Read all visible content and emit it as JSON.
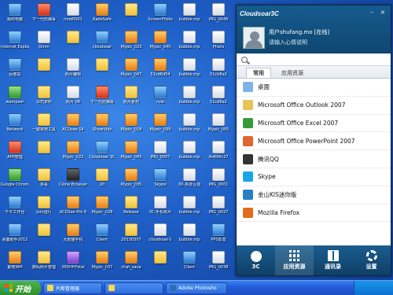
{
  "desktop": {
    "rows": [
      {
        "icons": [
          {
            "label": "我的电脑",
            "kind": "blue"
          },
          {
            "label": "下一代防病毒",
            "kind": "red"
          },
          {
            "label": "mod0001",
            "kind": "doc"
          },
          {
            "label": "RadeSafe",
            "kind": "orange"
          },
          {
            "label": "",
            "kind": "folder"
          },
          {
            "label": "ScreenPhoto",
            "kind": "blue"
          },
          {
            "label": "bubble.mp",
            "kind": "doc"
          },
          {
            "label": "IMG_0046",
            "kind": "doc"
          }
        ]
      },
      {
        "icons": [
          {
            "label": "Internet Explorer",
            "kind": "blue"
          },
          {
            "label": "Dmm",
            "kind": "doc"
          },
          {
            "label": "",
            "kind": "folder"
          },
          {
            "label": "cloudsoar",
            "kind": "blue"
          },
          {
            "label": "Mypic_023",
            "kind": "orange"
          },
          {
            "label": "Mypic_040",
            "kind": "orange"
          },
          {
            "label": "bubble.mp",
            "kind": "doc"
          },
          {
            "label": "Photo",
            "kind": "doc"
          }
        ]
      },
      {
        "icons": [
          {
            "label": "回收站",
            "kind": "blue"
          },
          {
            "label": "",
            "kind": "folder"
          },
          {
            "label": "照片编辑",
            "kind": "doc"
          },
          {
            "label": "",
            "kind": "folder"
          },
          {
            "label": "Mypic_047",
            "kind": "orange"
          },
          {
            "label": "51cd6d54",
            "kind": "orange"
          },
          {
            "label": "bubble.mp",
            "kind": "doc"
          },
          {
            "label": "51cb8a2",
            "kind": "doc"
          }
        ]
      },
      {
        "icons": [
          {
            "label": "wampser",
            "kind": "green"
          },
          {
            "label": "公司资料",
            "kind": "folder"
          },
          {
            "label": "照片 08",
            "kind": "doc"
          },
          {
            "label": "下一代防病毒",
            "kind": "red"
          },
          {
            "label": "照片素材",
            "kind": "folder"
          },
          {
            "label": "rule",
            "kind": "blue"
          },
          {
            "label": "bubble.mp",
            "kind": "doc"
          },
          {
            "label": "51cd8a2",
            "kind": "doc"
          }
        ]
      },
      {
        "icons": [
          {
            "label": "Network",
            "kind": "blue"
          },
          {
            "label": "一键常用工具",
            "kind": "folder"
          },
          {
            "label": "ACDsee 14",
            "kind": "orange"
          },
          {
            "label": "ShowVidz",
            "kind": "orange"
          },
          {
            "label": "Mypic_018",
            "kind": "orange"
          },
          {
            "label": "Mypic_099",
            "kind": "orange"
          },
          {
            "label": "bubble.mp",
            "kind": "doc"
          },
          {
            "label": "Mypic_005",
            "kind": "doc"
          }
        ]
      },
      {
        "icons": [
          {
            "label": "APP管理",
            "kind": "red"
          },
          {
            "label": "",
            "kind": "folder"
          },
          {
            "label": "Mypic_022",
            "kind": "orange"
          },
          {
            "label": "Cloudsoar 3C",
            "kind": "blue"
          },
          {
            "label": "Mypic_043",
            "kind": "orange"
          },
          {
            "label": "IMG_0007",
            "kind": "doc"
          },
          {
            "label": "bubble.mp",
            "kind": "doc"
          },
          {
            "label": "4e894c27",
            "kind": "doc"
          }
        ]
      },
      {
        "icons": [
          {
            "label": "Google Chrome",
            "kind": "green"
          },
          {
            "label": "多看",
            "kind": "folder"
          },
          {
            "label": "Clone Browser",
            "kind": "dark"
          },
          {
            "label": "20",
            "kind": "folder"
          },
          {
            "label": "Mypic_035",
            "kind": "orange"
          },
          {
            "label": "Skype",
            "kind": "blue"
          },
          {
            "label": "30-多屏互动",
            "kind": "doc"
          },
          {
            "label": "IMG_0001",
            "kind": "doc"
          }
        ]
      },
      {
        "icons": [
          {
            "label": "千牛工作台",
            "kind": "blue"
          },
          {
            "label": "Jotx运行",
            "kind": "folder"
          },
          {
            "label": "ACDSee Pro 6",
            "kind": "orange"
          },
          {
            "label": "Mypic_028",
            "kind": "orange"
          },
          {
            "label": "Release",
            "kind": "folder"
          },
          {
            "label": "3C-手机照片",
            "kind": "doc"
          },
          {
            "label": "bubble.mp",
            "kind": "doc"
          },
          {
            "label": "IMG_0027",
            "kind": "doc"
          }
        ]
      },
      {
        "icons": [
          {
            "label": "桌面助手2012",
            "kind": "blue"
          },
          {
            "label": "",
            "kind": "folder"
          },
          {
            "label": "大脸猫手机",
            "kind": "orange"
          },
          {
            "label": "Client",
            "kind": "blue"
          },
          {
            "label": "20130307",
            "kind": "folder"
          },
          {
            "label": "cloudsoar-1",
            "kind": "doc"
          },
          {
            "label": "bubble.mp",
            "kind": "doc"
          },
          {
            "label": "PPS影音",
            "kind": "blue"
          }
        ]
      },
      {
        "icons": [
          {
            "label": "紫苑Wifi",
            "kind": "orange"
          },
          {
            "label": "数码照片管理",
            "kind": "folder"
          },
          {
            "label": "360HHFetal",
            "kind": "purple"
          },
          {
            "label": "Mypic_037",
            "kind": "orange"
          },
          {
            "label": "chat_sava",
            "kind": "orange"
          },
          {
            "label": "",
            "kind": "folder"
          },
          {
            "label": "Client",
            "kind": "blue"
          },
          {
            "label": "IMG_0038",
            "kind": "doc"
          }
        ]
      }
    ]
  },
  "taskbar": {
    "start_label": "开始",
    "tasks": [
      "片断管理器",
      "",
      "Adobe Photosho"
    ]
  },
  "panel": {
    "title": "Cloudsoar3C",
    "window_buttons": [
      "–",
      "×"
    ],
    "user_name": "用户shufang.mo [在线]",
    "user_sub": "请输入心情说明",
    "search_placeholder": "",
    "tabs": [
      "常用",
      "应用资源"
    ],
    "active_tab": 0,
    "items": [
      {
        "label": "桌面",
        "icon": "desktop-icon",
        "color": "#7fb2e8"
      },
      {
        "label": "Microsoft Office Outlook 2007",
        "icon": "outlook-icon",
        "color": "#e8c35a"
      },
      {
        "label": "Microsoft Office Excel 2007",
        "icon": "excel-icon",
        "color": "#3a9a3a"
      },
      {
        "label": "Microsoft Office PowerPoint 2007",
        "icon": "powerpoint-icon",
        "color": "#e0662f"
      },
      {
        "label": "腾讯QQ",
        "icon": "qq-icon",
        "color": "#333333"
      },
      {
        "label": "Skype",
        "icon": "skype-icon",
        "color": "#18a6e8"
      },
      {
        "label": "金山KIS迷你版",
        "icon": "kis-icon",
        "color": "#2a7fc0"
      },
      {
        "label": "Mozilla Firefox",
        "icon": "firefox-icon",
        "color": "#e46a1c"
      }
    ],
    "footer": [
      {
        "label": "3C",
        "icon": "chat-icon"
      },
      {
        "label": "应用资源",
        "icon": "apps-icon"
      },
      {
        "label": "通讯录",
        "icon": "contacts-icon"
      },
      {
        "label": "设置",
        "icon": "settings-icon"
      }
    ],
    "active_footer": 1
  }
}
